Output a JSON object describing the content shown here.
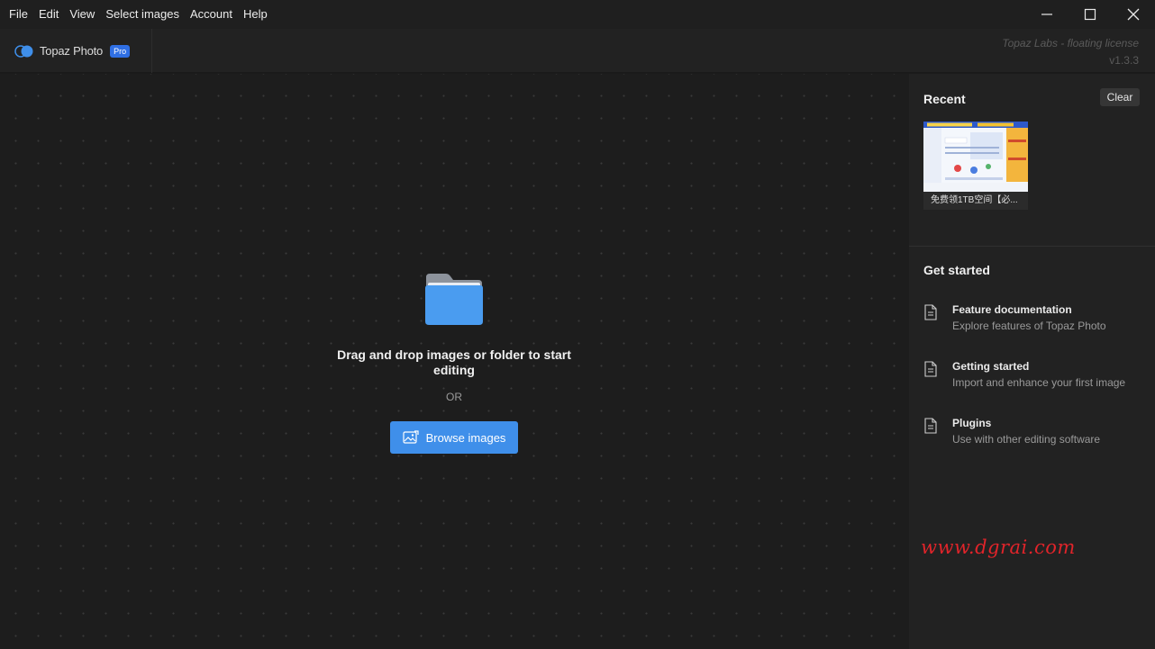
{
  "menubar": {
    "items": [
      "File",
      "Edit",
      "View",
      "Select images",
      "Account",
      "Help"
    ]
  },
  "window_controls": [
    "minimize-icon",
    "maximize-icon",
    "close-icon"
  ],
  "app": {
    "name": "Topaz Photo",
    "badge": "Pro",
    "license": "Topaz Labs - floating license",
    "version": "v1.3.3"
  },
  "dropzone": {
    "icon": "folder-icon",
    "title": "Drag and drop images or folder to start editing",
    "or": "OR",
    "browse_label": "Browse images",
    "browse_icon": "image-icon"
  },
  "sidebar": {
    "recent_title": "Recent",
    "clear_label": "Clear",
    "recent_items": [
      {
        "caption": "免费领1TB空间【必..."
      }
    ],
    "get_started_title": "Get started",
    "links": [
      {
        "title": "Feature documentation",
        "subtitle": "Explore features of Topaz Photo",
        "icon": "document-icon"
      },
      {
        "title": "Getting started",
        "subtitle": "Import and enhance your first image",
        "icon": "document-icon"
      },
      {
        "title": "Plugins",
        "subtitle": "Use with other editing software",
        "icon": "document-icon"
      }
    ]
  },
  "watermark": "www.dgrai.com",
  "colors": {
    "accent": "#3f8fea",
    "badge": "#2f6fe4",
    "watermark": "#e0242a"
  }
}
